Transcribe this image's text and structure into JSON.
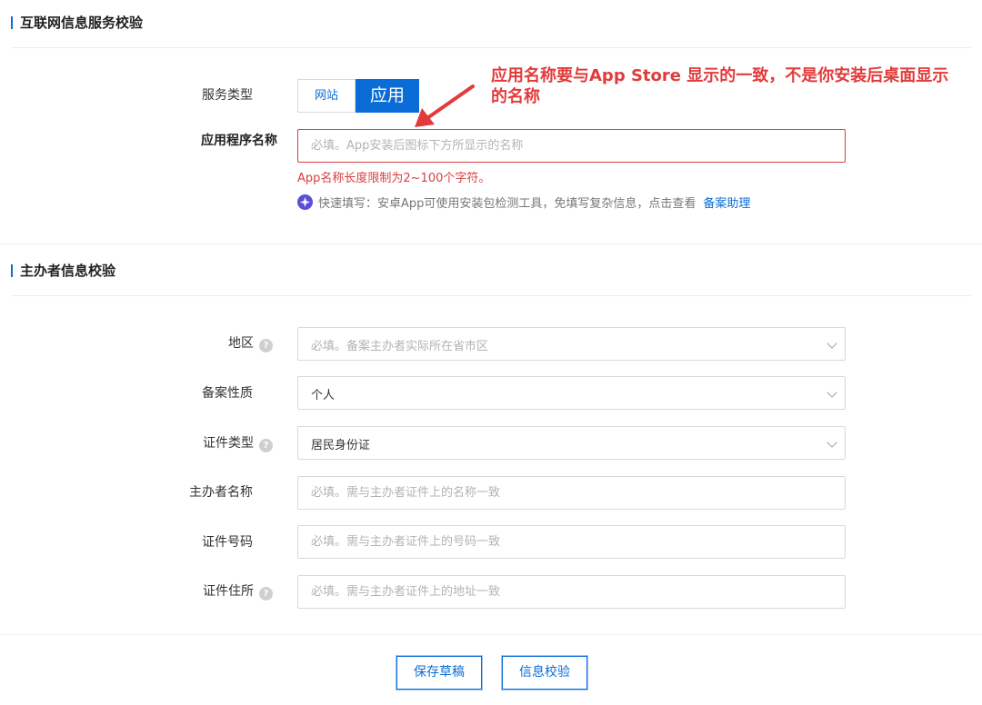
{
  "section1": {
    "title": "互联网信息服务校验",
    "service_type_label": "服务类型",
    "service_options": [
      "网站",
      "应用"
    ],
    "app_name_label": "应用程序名称",
    "app_name_placeholder": "必填。App安装后图标下方所显示的名称",
    "error_text": "App名称长度限制为2~100个字符。",
    "tip_text": "快速填写：安卓App可使用安装包检测工具，免填写复杂信息，点击查看",
    "tip_link": "备案助理"
  },
  "annotation": {
    "text": "应用名称要与App Store 显示的一致，不是你安装后桌面显示的名称",
    "color": "#e23b3b"
  },
  "section2": {
    "title": "主办者信息校验",
    "region_label": "地区",
    "region_placeholder": "必填。备案主办者实际所在省市区",
    "nature_label": "备案性质",
    "nature_value": "个人",
    "id_type_label": "证件类型",
    "id_type_value": "居民身份证",
    "sponsor_name_label": "主办者名称",
    "sponsor_name_placeholder": "必填。需与主办者证件上的名称一致",
    "id_number_label": "证件号码",
    "id_number_placeholder": "必填。需与主办者证件上的号码一致",
    "id_address_label": "证件住所",
    "id_address_placeholder": "必填。需与主办者证件上的地址一致"
  },
  "footer": {
    "save_draft": "保存草稿",
    "verify": "信息校验"
  },
  "icons": {
    "help": "question-circle-icon",
    "tip": "compass-star-icon",
    "dropdown": "chevron-down-icon"
  },
  "colors": {
    "accent": "#0a6cd6",
    "error": "#d93e3e"
  }
}
